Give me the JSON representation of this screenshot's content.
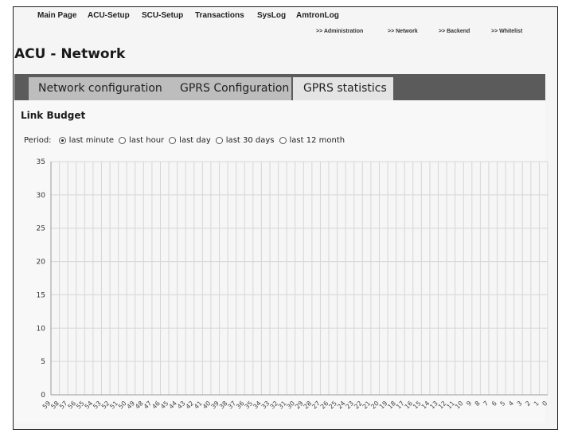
{
  "top_nav": [
    "Main Page",
    "ACU-Setup",
    "SCU-Setup",
    "Transactions",
    "SysLog",
    "AmtronLog"
  ],
  "sub_nav": [
    ">> Administration",
    ">> Network",
    ">> Backend",
    ">> Whitelist"
  ],
  "page_title": "ACU - Network",
  "tabs": [
    {
      "label": "Network configuration",
      "active": false
    },
    {
      "label": "GPRS Configuration",
      "active": false
    },
    {
      "label": "GPRS statistics",
      "active": true
    }
  ],
  "section_title": "Link Budget",
  "period": {
    "label": "Period:",
    "options": [
      {
        "label": "last minute",
        "checked": true
      },
      {
        "label": "last hour",
        "checked": false
      },
      {
        "label": "last day",
        "checked": false
      },
      {
        "label": "last 30 days",
        "checked": false
      },
      {
        "label": "last 12 month",
        "checked": false
      }
    ]
  },
  "colors": {
    "tab_bar": "#5b5b5b",
    "tab_inactive": "#bdbdbd",
    "tab_active": "#e4e4e4",
    "grid": "#d6d6d6"
  },
  "chart_data": {
    "type": "line",
    "title": "",
    "xlabel": "",
    "ylabel": "",
    "y_ticks": [
      0,
      5,
      10,
      15,
      20,
      25,
      30,
      35
    ],
    "ylim": [
      0,
      35
    ],
    "x": [
      59,
      58,
      57,
      56,
      55,
      54,
      53,
      52,
      51,
      50,
      49,
      48,
      47,
      46,
      45,
      44,
      43,
      42,
      41,
      40,
      39,
      38,
      37,
      36,
      35,
      34,
      33,
      32,
      31,
      30,
      29,
      28,
      27,
      26,
      25,
      24,
      23,
      22,
      21,
      20,
      19,
      18,
      17,
      16,
      15,
      14,
      13,
      12,
      11,
      10,
      9,
      8,
      7,
      6,
      5,
      4,
      3,
      2,
      1,
      0
    ],
    "series": [],
    "grid": true
  }
}
